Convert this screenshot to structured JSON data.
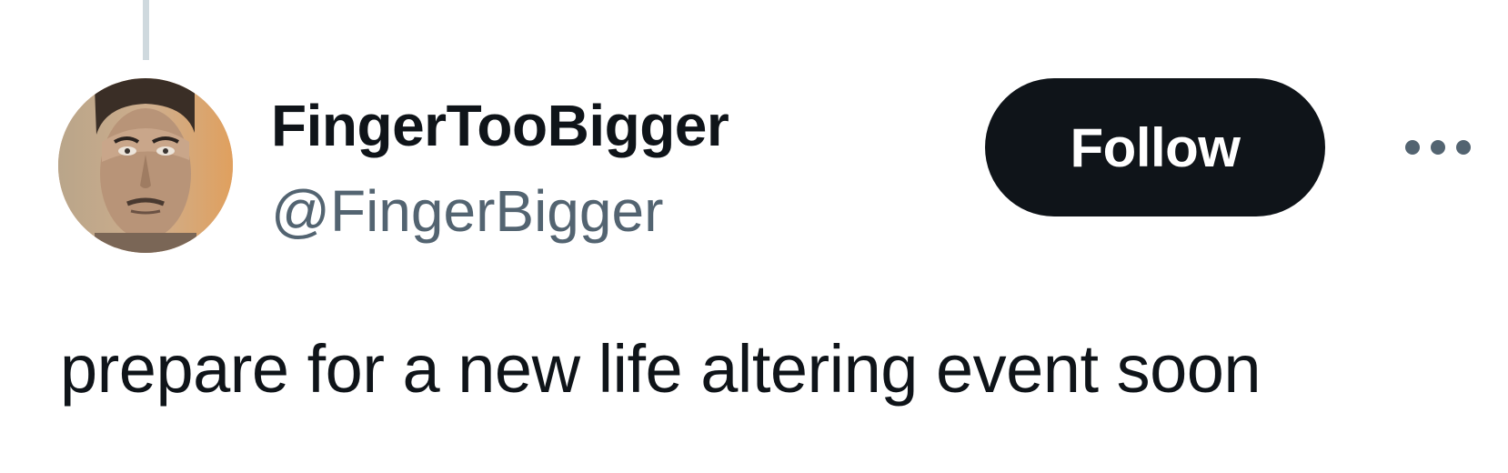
{
  "tweet": {
    "author": {
      "display_name": "FingerTooBigger",
      "handle": "@FingerBigger"
    },
    "follow_label": "Follow",
    "more_icon": "more-horizontal-icon",
    "text": "prepare for a new life altering event soon"
  },
  "colors": {
    "primary_text": "#0f1419",
    "secondary_text": "#536471",
    "thread_line": "#cfd9de",
    "follow_button_bg": "#0f1419",
    "follow_button_text": "#ffffff"
  }
}
